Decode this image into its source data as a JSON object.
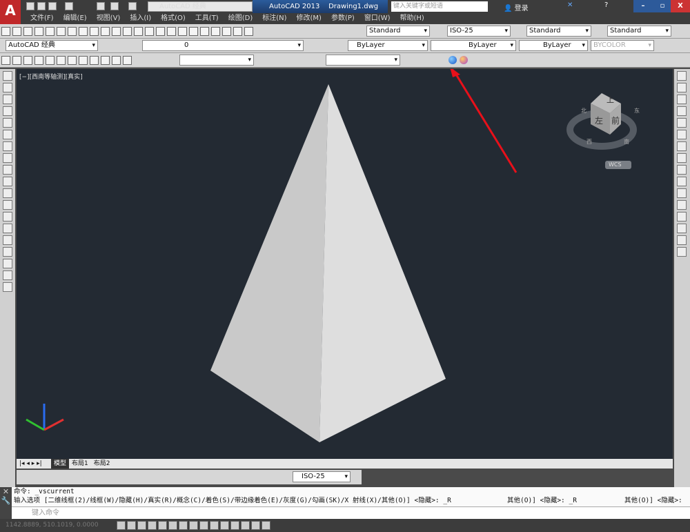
{
  "app": {
    "title": "AutoCAD 2013",
    "document": "Drawing1.dwg",
    "workspace": "AutoCAD 经典",
    "search_placeholder": "键入关键字或短语",
    "login": "登录"
  },
  "menu": [
    "文件(F)",
    "编辑(E)",
    "视图(V)",
    "插入(I)",
    "格式(O)",
    "工具(T)",
    "绘图(D)",
    "标注(N)",
    "修改(M)",
    "参数(P)",
    "窗口(W)",
    "帮助(H)"
  ],
  "styles": {
    "text_style": "Standard",
    "dim_style": "ISO-25",
    "table_style": "Standard",
    "mleader_style": "Standard"
  },
  "layers": {
    "workspace": "AutoCAD 经典",
    "layer": "0",
    "color": "ByLayer",
    "linetype": "ByLayer",
    "lineweight": "ByLayer",
    "plotstyle": "BYCOLOR"
  },
  "viewport": {
    "label": "[−][西南等轴测][真实]",
    "viewcube": {
      "top": "上",
      "left": "左",
      "front": "前",
      "north": "北",
      "west": "西",
      "south": "南",
      "east": "东",
      "wcs": "WCS"
    },
    "colors": {
      "background": "#232a33",
      "face_left": "#c9c9c9",
      "face_right": "#dedede",
      "annotation": "#e8101a"
    }
  },
  "layout_tabs": [
    "模型",
    "布局1",
    "布局2"
  ],
  "dim_toolbar": {
    "dim_style": "ISO-25"
  },
  "command": {
    "history": [
      "命令: _vscurrent",
      "输入选项 [二维线框(2)/线框(W)/隐藏(H)/真实(R)/概念(C)/着色(S)/带边缘着色(E)/灰度(G)/勾画(SK)/X 射线(X)/其他(O)] <隐藏>: _R"
    ],
    "overflow1": "其他(O)] <隐藏>: _R",
    "overflow2": "其他(O)] <隐藏>:",
    "placeholder": "键入命令"
  },
  "status": {
    "coords": "1142.8889, 510.1019, 0.0000"
  }
}
